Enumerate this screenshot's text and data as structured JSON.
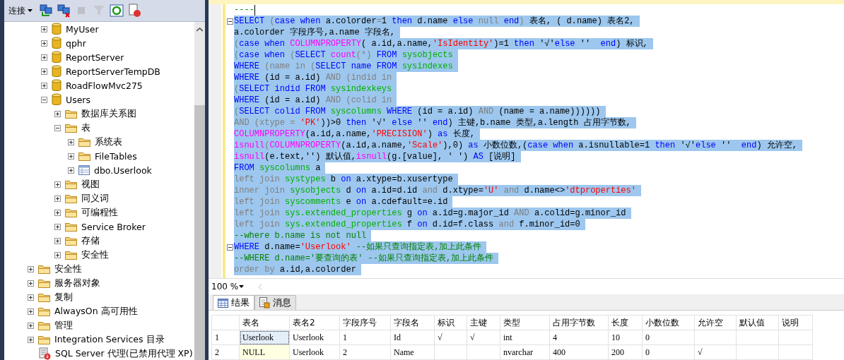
{
  "object_explorer": {
    "toolbar": {
      "connect_label": "连接",
      "tools": [
        {
          "kind": "connect",
          "disabled": false
        },
        {
          "kind": "disconnect",
          "disabled": false
        },
        {
          "kind": "stop",
          "disabled": true
        },
        {
          "kind": "filter",
          "disabled": true
        },
        {
          "kind": "refresh",
          "disabled": false
        },
        {
          "kind": "stop-activity",
          "disabled": false
        }
      ]
    },
    "databases": [
      {
        "label": "MyUser",
        "kind": "database",
        "expanded": false
      },
      {
        "label": "qphr",
        "kind": "database",
        "expanded": false
      },
      {
        "label": "ReportServer",
        "kind": "database",
        "expanded": false
      },
      {
        "label": "ReportServerTempDB",
        "kind": "database",
        "expanded": false
      },
      {
        "label": "RoadFlowMvc275",
        "kind": "database",
        "expanded": false
      },
      {
        "label": "Users",
        "kind": "database",
        "expanded": true,
        "children": [
          {
            "label": "数据库关系图",
            "kind": "folder",
            "expanded": false
          },
          {
            "label": "表",
            "kind": "folder",
            "expanded": true,
            "children": [
              {
                "label": "系统表",
                "kind": "folder",
                "expanded": false
              },
              {
                "label": "FileTables",
                "kind": "folder",
                "expanded": false
              },
              {
                "label": "dbo.Userlook",
                "kind": "table",
                "expanded": false
              }
            ]
          },
          {
            "label": "视图",
            "kind": "folder",
            "expanded": false
          },
          {
            "label": "同义词",
            "kind": "folder",
            "expanded": false
          },
          {
            "label": "可编程性",
            "kind": "folder",
            "expanded": false
          },
          {
            "label": "Service Broker",
            "kind": "folder",
            "expanded": false
          },
          {
            "label": "存储",
            "kind": "folder",
            "expanded": false
          },
          {
            "label": "安全性",
            "kind": "folder",
            "expanded": false
          }
        ]
      }
    ],
    "server_nodes": [
      {
        "label": "安全性",
        "kind": "folder",
        "expanded": false
      },
      {
        "label": "服务器对象",
        "kind": "folder",
        "expanded": false
      },
      {
        "label": "复制",
        "kind": "folder",
        "expanded": false
      },
      {
        "label": "AlwaysOn 高可用性",
        "kind": "folder",
        "expanded": false
      },
      {
        "label": "管理",
        "kind": "folder",
        "expanded": false
      },
      {
        "label": "Integration Services 目录",
        "kind": "folder",
        "expanded": false
      },
      {
        "label": "SQL Server 代理(已禁用代理 XP)",
        "kind": "agent"
      }
    ]
  },
  "editor": {
    "lines": [
      {
        "selected": false,
        "caret": true,
        "tokens": [
          {
            "text": "----",
            "kind": "cmt"
          }
        ]
      },
      {
        "selected": true,
        "fold": true,
        "tokens": [
          {
            "text": "SELECT",
            "kind": "kw"
          },
          {
            "text": " (",
            "kind": "gray"
          },
          {
            "text": "case when",
            "kind": "kw"
          },
          {
            "text": " a.colorder",
            "kind": "txt"
          },
          {
            "text": "=",
            "kind": "gray"
          },
          {
            "text": "1 ",
            "kind": "txt"
          },
          {
            "text": "then",
            "kind": "kw"
          },
          {
            "text": " d.name ",
            "kind": "txt"
          },
          {
            "text": "else",
            "kind": "kw"
          },
          {
            "text": " null",
            "kind": "gray"
          },
          {
            "text": " end",
            "kind": "kw"
          },
          {
            "text": ")",
            "kind": "gray"
          },
          {
            "text": " 表名, ( d.name) 表名2,",
            "kind": "txt"
          }
        ]
      },
      {
        "selected": true,
        "tokens": [
          {
            "text": "a.colorder 字段序号,a.name 字段名,",
            "kind": "txt"
          }
        ]
      },
      {
        "selected": true,
        "tokens": [
          {
            "text": "(",
            "kind": "gray"
          },
          {
            "text": "case when ",
            "kind": "kw"
          },
          {
            "text": "COLUMNPROPERTY",
            "kind": "fn"
          },
          {
            "text": "( a.id,a.name,",
            "kind": "txt"
          },
          {
            "text": "'IsIdentity'",
            "kind": "str"
          },
          {
            "text": ")=1 ",
            "kind": "txt"
          },
          {
            "text": "then ",
            "kind": "kw"
          },
          {
            "text": "'√'",
            "kind": "txt"
          },
          {
            "text": "else ",
            "kind": "kw"
          },
          {
            "text": "'' ",
            "kind": "txt"
          },
          {
            "text": " end",
            "kind": "kw"
          },
          {
            "text": ") 标识,",
            "kind": "txt"
          }
        ]
      },
      {
        "selected": true,
        "tokens": [
          {
            "text": "(",
            "kind": "gray"
          },
          {
            "text": "case when ",
            "kind": "kw"
          },
          {
            "text": "(",
            "kind": "gray"
          },
          {
            "text": "SELECT ",
            "kind": "kw"
          },
          {
            "text": "count",
            "kind": "fn"
          },
          {
            "text": "(*) ",
            "kind": "gray"
          },
          {
            "text": "FROM ",
            "kind": "kw"
          },
          {
            "text": "sysobjects",
            "kind": "sys"
          }
        ]
      },
      {
        "selected": true,
        "tokens": [
          {
            "text": "WHERE",
            "kind": "kw"
          },
          {
            "text": " (name in (",
            "kind": "gray"
          },
          {
            "text": "SELECT name FROM ",
            "kind": "kw"
          },
          {
            "text": "sysindexes",
            "kind": "sys"
          }
        ]
      },
      {
        "selected": true,
        "tokens": [
          {
            "text": "WHERE ",
            "kind": "kw"
          },
          {
            "text": "(id = a.id) ",
            "kind": "txt"
          },
          {
            "text": "AND (indid in",
            "kind": "gray"
          }
        ]
      },
      {
        "selected": true,
        "tokens": [
          {
            "text": "(",
            "kind": "gray"
          },
          {
            "text": "SELECT indid FROM ",
            "kind": "kw"
          },
          {
            "text": "sysindexkeys",
            "kind": "sys"
          }
        ]
      },
      {
        "selected": true,
        "tokens": [
          {
            "text": "WHERE ",
            "kind": "kw"
          },
          {
            "text": "(id = a.id) ",
            "kind": "txt"
          },
          {
            "text": "AND (colid in",
            "kind": "gray"
          }
        ]
      },
      {
        "selected": true,
        "tokens": [
          {
            "text": "(",
            "kind": "gray"
          },
          {
            "text": "SELECT colid FROM ",
            "kind": "kw"
          },
          {
            "text": "syscolumns ",
            "kind": "sys"
          },
          {
            "text": "WHERE ",
            "kind": "kw"
          },
          {
            "text": "(id = a.id) ",
            "kind": "txt"
          },
          {
            "text": "AND ",
            "kind": "gray"
          },
          {
            "text": "(name = a.name))))))",
            "kind": "txt"
          }
        ]
      },
      {
        "selected": true,
        "tokens": [
          {
            "text": "AND (xtype = ",
            "kind": "gray"
          },
          {
            "text": "'PK'",
            "kind": "str"
          },
          {
            "text": "))>0 ",
            "kind": "txt"
          },
          {
            "text": "then ",
            "kind": "kw"
          },
          {
            "text": "'√' ",
            "kind": "txt"
          },
          {
            "text": "else ",
            "kind": "kw"
          },
          {
            "text": "'' ",
            "kind": "txt"
          },
          {
            "text": "end",
            "kind": "kw"
          },
          {
            "text": ") 主键,b.name 类型,a.length 占用字节数,",
            "kind": "txt"
          }
        ]
      },
      {
        "selected": true,
        "tokens": [
          {
            "text": "COLUMNPROPERTY",
            "kind": "fn"
          },
          {
            "text": "(a.id,a.name,",
            "kind": "txt"
          },
          {
            "text": "'PRECISION'",
            "kind": "str"
          },
          {
            "text": ") ",
            "kind": "txt"
          },
          {
            "text": "as ",
            "kind": "kw"
          },
          {
            "text": "长度,",
            "kind": "txt"
          }
        ]
      },
      {
        "selected": true,
        "tokens": [
          {
            "text": "isnull",
            "kind": "fn"
          },
          {
            "text": "(",
            "kind": "gray"
          },
          {
            "text": "COLUMNPROPERTY",
            "kind": "fn"
          },
          {
            "text": "(a.id,a.name,",
            "kind": "txt"
          },
          {
            "text": "'Scale'",
            "kind": "str"
          },
          {
            "text": "),0) ",
            "kind": "txt"
          },
          {
            "text": "as ",
            "kind": "kw"
          },
          {
            "text": "小数位数,(",
            "kind": "txt"
          },
          {
            "text": "case when ",
            "kind": "kw"
          },
          {
            "text": "a.isnullable=1 ",
            "kind": "txt"
          },
          {
            "text": "then ",
            "kind": "kw"
          },
          {
            "text": "'√'",
            "kind": "txt"
          },
          {
            "text": "else ",
            "kind": "kw"
          },
          {
            "text": "'' ",
            "kind": "txt"
          },
          {
            "text": " end",
            "kind": "kw"
          },
          {
            "text": ") 允许空,",
            "kind": "txt"
          }
        ]
      },
      {
        "selected": true,
        "tokens": [
          {
            "text": "isnull",
            "kind": "fn"
          },
          {
            "text": "(e.text,'') 默认值,",
            "kind": "txt"
          },
          {
            "text": "isnull",
            "kind": "fn"
          },
          {
            "text": "(g.[value], ' ') ",
            "kind": "txt"
          },
          {
            "text": "AS ",
            "kind": "kw"
          },
          {
            "text": "[说明]",
            "kind": "txt"
          }
        ]
      },
      {
        "selected": true,
        "tokens": [
          {
            "text": "FROM ",
            "kind": "kw"
          },
          {
            "text": "syscolumns ",
            "kind": "sys"
          },
          {
            "text": "a",
            "kind": "txt"
          }
        ]
      },
      {
        "selected": true,
        "tokens": [
          {
            "text": "left join ",
            "kind": "gray"
          },
          {
            "text": "systypes ",
            "kind": "sys"
          },
          {
            "text": "b ",
            "kind": "txt"
          },
          {
            "text": "on ",
            "kind": "kw"
          },
          {
            "text": "a.xtype=b.xusertype",
            "kind": "txt"
          }
        ]
      },
      {
        "selected": true,
        "tokens": [
          {
            "text": "inner join ",
            "kind": "gray"
          },
          {
            "text": "sysobjects ",
            "kind": "sys"
          },
          {
            "text": "d ",
            "kind": "txt"
          },
          {
            "text": "on ",
            "kind": "kw"
          },
          {
            "text": "a.id=d.id ",
            "kind": "txt"
          },
          {
            "text": "and ",
            "kind": "gray"
          },
          {
            "text": "d.xtype=",
            "kind": "txt"
          },
          {
            "text": "'U'",
            "kind": "str"
          },
          {
            "text": " and ",
            "kind": "gray"
          },
          {
            "text": "d.name<>",
            "kind": "txt"
          },
          {
            "text": "'dtproperties'",
            "kind": "str"
          }
        ]
      },
      {
        "selected": true,
        "tokens": [
          {
            "text": "left join ",
            "kind": "gray"
          },
          {
            "text": "syscomments ",
            "kind": "sys"
          },
          {
            "text": "e ",
            "kind": "txt"
          },
          {
            "text": "on ",
            "kind": "kw"
          },
          {
            "text": "a.cdefault=e.id",
            "kind": "txt"
          }
        ]
      },
      {
        "selected": true,
        "tokens": [
          {
            "text": "left join ",
            "kind": "gray"
          },
          {
            "text": "sys.extended_properties ",
            "kind": "sys"
          },
          {
            "text": "g ",
            "kind": "txt"
          },
          {
            "text": "on ",
            "kind": "kw"
          },
          {
            "text": "a.id=g.major_id ",
            "kind": "txt"
          },
          {
            "text": "AND ",
            "kind": "gray"
          },
          {
            "text": "a.colid=g.minor_id",
            "kind": "txt"
          }
        ]
      },
      {
        "selected": true,
        "tokens": [
          {
            "text": "left join ",
            "kind": "gray"
          },
          {
            "text": "sys.extended_properties ",
            "kind": "sys"
          },
          {
            "text": "f ",
            "kind": "txt"
          },
          {
            "text": "on ",
            "kind": "kw"
          },
          {
            "text": "d.id=f.class ",
            "kind": "txt"
          },
          {
            "text": "and ",
            "kind": "gray"
          },
          {
            "text": "f.minor_id=0",
            "kind": "txt"
          }
        ]
      },
      {
        "selected": true,
        "tokens": [
          {
            "text": "--where b.name is not null",
            "kind": "cmt"
          }
        ]
      },
      {
        "selected": true,
        "fold": true,
        "tokens": [
          {
            "text": "WHERE ",
            "kind": "kw"
          },
          {
            "text": "d.name=",
            "kind": "txt"
          },
          {
            "text": "'Userlook'",
            "kind": "str"
          },
          {
            "text": " --如果只查询指定表,加上此条件",
            "kind": "cmt"
          }
        ]
      },
      {
        "selected": true,
        "tokens": [
          {
            "text": "--WHERE d.name='要查询的表' --如果只查询指定表,加上此条件",
            "kind": "cmt"
          }
        ]
      },
      {
        "selected": true,
        "tokens": [
          {
            "text": "order by ",
            "kind": "gray"
          },
          {
            "text": "a.id,a.colorder",
            "kind": "txt"
          }
        ]
      }
    ],
    "zoom": "100 %"
  },
  "result_tabs": [
    {
      "label": "结果",
      "kind": "grid",
      "selected": true
    },
    {
      "label": "消息",
      "kind": "message",
      "selected": false
    }
  ],
  "results": {
    "columns": [
      "表名",
      "表名2",
      "字段序号",
      "字段名",
      "标识",
      "主键",
      "类型",
      "占用字节数",
      "长度",
      "小数位数",
      "允许空",
      "默认值",
      "说明"
    ],
    "rows": [
      {
        "number": "1",
        "cells": [
          {
            "text": "Userlook",
            "selected": true,
            "null": false
          },
          {
            "text": "Userlook",
            "selected": false,
            "null": false
          },
          {
            "text": "1",
            "selected": false,
            "null": false
          },
          {
            "text": "Id",
            "selected": false,
            "null": false
          },
          {
            "text": "√",
            "selected": false,
            "null": false
          },
          {
            "text": "√",
            "selected": false,
            "null": false
          },
          {
            "text": "int",
            "selected": false,
            "null": false
          },
          {
            "text": "4",
            "selected": false,
            "null": false
          },
          {
            "text": "10",
            "selected": false,
            "null": false
          },
          {
            "text": "0",
            "selected": false,
            "null": false
          },
          {
            "selected": false,
            "null": false
          },
          {
            "selected": false,
            "null": false
          },
          {
            "selected": false,
            "null": false
          }
        ]
      },
      {
        "number": "2",
        "cells": [
          {
            "text": "NULL",
            "selected": false,
            "null": true
          },
          {
            "text": "Userlook",
            "selected": false,
            "null": false
          },
          {
            "text": "2",
            "selected": false,
            "null": false
          },
          {
            "text": "Name",
            "selected": false,
            "null": false
          },
          {
            "selected": false,
            "null": false
          },
          {
            "selected": false,
            "null": false
          },
          {
            "text": "nvarchar",
            "selected": false,
            "null": false
          },
          {
            "text": "400",
            "selected": false,
            "null": false
          },
          {
            "text": "200",
            "selected": false,
            "null": false
          },
          {
            "text": "0",
            "selected": false,
            "null": false
          },
          {
            "text": "√",
            "selected": false,
            "null": false
          },
          {
            "selected": false,
            "null": false
          },
          {
            "selected": false,
            "null": false
          }
        ]
      }
    ]
  }
}
